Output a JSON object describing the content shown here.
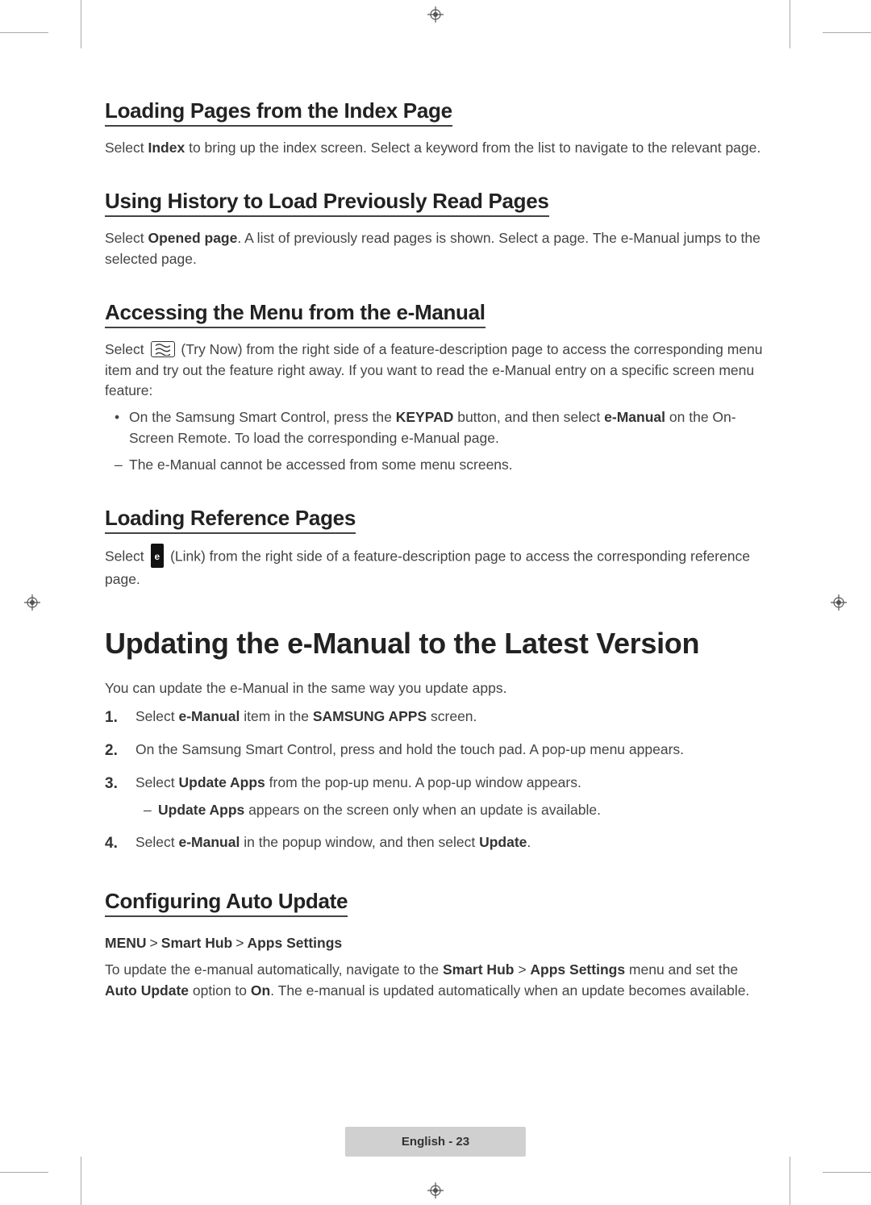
{
  "section1": {
    "heading": "Loading Pages from the Index Page",
    "para_a": "Select ",
    "para_b": "Index",
    "para_c": " to bring up the index screen. Select a keyword from the list to navigate to the relevant page."
  },
  "section2": {
    "heading": "Using History to Load Previously Read Pages",
    "para_a": "Select ",
    "para_b": "Opened page",
    "para_c": ". A list of previously read pages is shown. Select a page. The e-Manual jumps to the selected page."
  },
  "section3": {
    "heading": "Accessing the Menu from the e-Manual",
    "para_a": "Select ",
    "para_c": " (Try Now) from the right side of a feature-description page to access the corresponding menu item and try out the feature right away. If you want to read the e-Manual entry on a specific screen menu feature:",
    "bullet1_a": "On the Samsung Smart Control, press the ",
    "bullet1_b": "KEYPAD",
    "bullet1_c": " button, and then select ",
    "bullet1_d": "e-Manual",
    "bullet1_e": " on the On-Screen Remote. To load the corresponding e-Manual page.",
    "dash1": "The e-Manual cannot be accessed from some menu screens."
  },
  "section4": {
    "heading": "Loading Reference Pages",
    "para_a": "Select ",
    "para_c": " (Link) from the right side of a feature-description page to access the corresponding reference page."
  },
  "major": {
    "heading": "Updating the e-Manual to the Latest Version",
    "intro": "You can update the e-Manual in the same way you update apps.",
    "step1_a": "Select ",
    "step1_b": "e-Manual",
    "step1_c": " item in the ",
    "step1_d": "SAMSUNG APPS",
    "step1_e": " screen.",
    "step2": "On the Samsung Smart Control, press and hold the touch pad. A pop-up menu appears.",
    "step3_a": "Select ",
    "step3_b": "Update Apps",
    "step3_c": " from the pop-up menu. A pop-up window appears.",
    "step3_sub_a": "Update Apps",
    "step3_sub_b": " appears on the screen only when an update is available.",
    "step4_a": "Select ",
    "step4_b": "e-Manual",
    "step4_c": " in the popup window, and then select ",
    "step4_d": "Update",
    "step4_e": ".",
    "n1": "1.",
    "n2": "2.",
    "n3": "3.",
    "n4": "4."
  },
  "section5": {
    "heading": "Configuring Auto Update",
    "path_a": "MENU",
    "path_b": "Smart Hub",
    "path_c": "Apps Settings",
    "para_a": "To update the e-manual automatically, navigate to the ",
    "para_b": "Smart Hub",
    "para_c": " > ",
    "para_d": "Apps Settings",
    "para_e": " menu and set the ",
    "para_f": "Auto Update",
    "para_g": " option to ",
    "para_h": "On",
    "para_i": ". The e-manual is updated automatically when an update becomes available."
  },
  "footer": {
    "lang": "English",
    "sep": " - ",
    "page": "23"
  },
  "chev": ">"
}
